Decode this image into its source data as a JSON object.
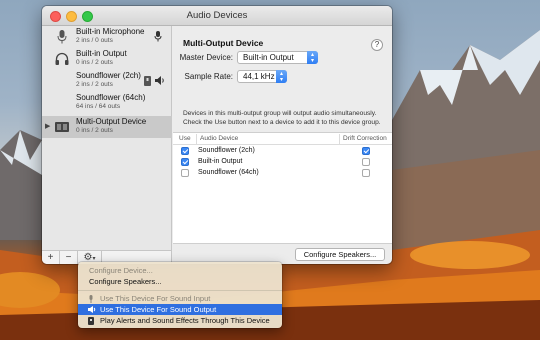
{
  "window": {
    "title": "Audio Devices"
  },
  "sidebar": {
    "devices": [
      {
        "name": "Built-in Microphone",
        "sub": "2 ins / 0 outs",
        "icon": "microphone-icon",
        "right_icon": "microphone-icon"
      },
      {
        "name": "Built-in Output",
        "sub": "0 ins / 2 outs",
        "icon": "headphones-icon",
        "right_icon": ""
      },
      {
        "name": "Soundflower (2ch)",
        "sub": "2 ins / 2 outs",
        "icon": "",
        "right_icon": "speaker-icon"
      },
      {
        "name": "Soundflower (64ch)",
        "sub": "64 ins / 64 outs",
        "icon": "",
        "right_icon": ""
      },
      {
        "name": "Multi-Output Device",
        "sub": "0 ins / 2 outs",
        "icon": "multi-output-icon",
        "right_icon": "",
        "selected": true
      }
    ],
    "bottom": {
      "add": "+",
      "remove": "−",
      "gear": "⚙",
      "chevron": "▾"
    }
  },
  "panel": {
    "title": "Multi-Output Device",
    "help": "?",
    "master_label": "Master Device:",
    "master_value": "Built-in Output",
    "rate_label": "Sample Rate:",
    "rate_value": "44,1 kHz",
    "description": "Devices in this multi-output group will output audio simultaneously. Check the Use button next to a device to add it to this device group.",
    "table": {
      "headers": {
        "use": "Use",
        "device": "Audio Device",
        "drift": "Drift Correction"
      },
      "rows": [
        {
          "name": "Soundflower (2ch)",
          "use": true,
          "drift": true
        },
        {
          "name": "Built-in Output",
          "use": true,
          "drift": false
        },
        {
          "name": "Soundflower (64ch)",
          "use": false,
          "drift": false
        }
      ]
    },
    "configure_button": "Configure Speakers..."
  },
  "menu": {
    "items": [
      {
        "label": "Configure Device...",
        "disabled": true
      },
      {
        "label": "Configure Speakers...",
        "disabled": false
      },
      {
        "label": "Use This Device For Sound Input",
        "disabled": true,
        "icon": "microphone-icon"
      },
      {
        "label": "Use This Device For Sound Output",
        "highlighted": true,
        "icon": "speaker-icon"
      },
      {
        "label": "Play Alerts and Sound Effects Through This Device",
        "disabled": false,
        "icon": "alert-speaker-icon"
      }
    ]
  }
}
